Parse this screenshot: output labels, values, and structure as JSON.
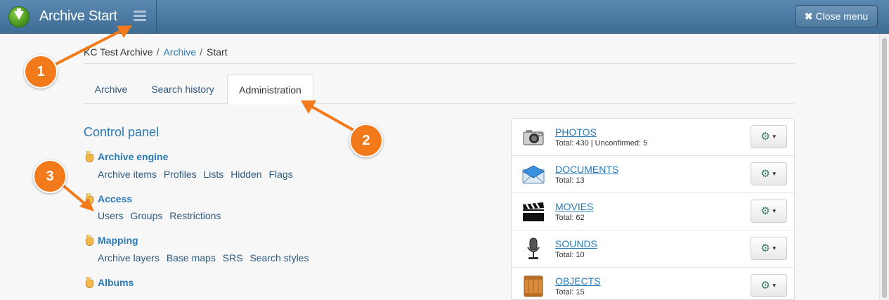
{
  "header": {
    "title": "Archive Start",
    "close_menu_label": "Close menu",
    "close_icon": "✖"
  },
  "breadcrumb": {
    "root": "KC Test Archive",
    "link": "Archive",
    "current": "Start",
    "separator": "/"
  },
  "tabs": [
    {
      "label": "Archive"
    },
    {
      "label": "Search history"
    },
    {
      "label": "Administration",
      "active": true
    }
  ],
  "control_panel": {
    "title": "Control panel",
    "sections": [
      {
        "title": "Archive engine",
        "links": [
          "Archive items",
          "Profiles",
          "Lists",
          "Hidden",
          "Flags"
        ]
      },
      {
        "title": "Access",
        "links": [
          "Users",
          "Groups",
          "Restrictions"
        ]
      },
      {
        "title": "Mapping",
        "links": [
          "Archive layers",
          "Base maps",
          "SRS",
          "Search styles"
        ]
      },
      {
        "title": "Albums",
        "links": []
      }
    ]
  },
  "collections": [
    {
      "name": "PHOTOS",
      "meta": "Total: 430 | Unconfirmed: 5",
      "icon": "camera-icon"
    },
    {
      "name": "DOCUMENTS",
      "meta": "Total: 13",
      "icon": "envelope-icon"
    },
    {
      "name": "MOVIES",
      "meta": "Total: 62",
      "icon": "clapperboard-icon"
    },
    {
      "name": "SOUNDS",
      "meta": "Total: 10",
      "icon": "microphone-icon"
    },
    {
      "name": "OBJECTS",
      "meta": "Total: 15",
      "icon": "crate-icon"
    }
  ],
  "gear_glyph": "⚙",
  "caret_glyph": "▼",
  "callouts": [
    "1",
    "2",
    "3"
  ],
  "colors": {
    "callout": "#f27a1a",
    "link": "#2a7ab8",
    "topbar": "#4a78a0"
  }
}
